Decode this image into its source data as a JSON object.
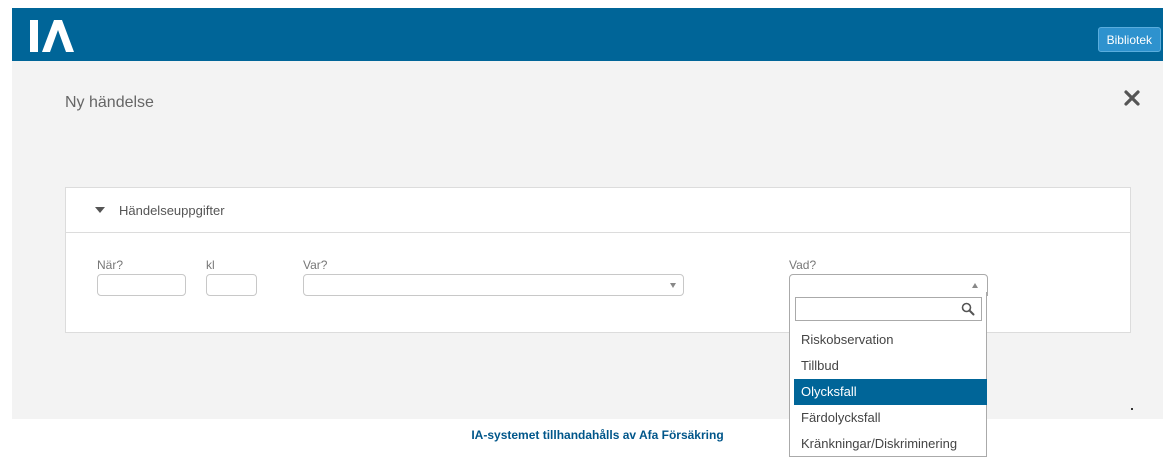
{
  "header": {
    "logo_text": "IA",
    "library_button": "Bibliotek",
    "brand_color": "#006598"
  },
  "dialog": {
    "title": "Ny händelse",
    "close_icon": "close-icon"
  },
  "section": {
    "title": "Händelseuppgifter",
    "expanded": true
  },
  "form": {
    "when_label": "När?",
    "when_value": "",
    "time_label": "kl",
    "time_value": "",
    "where_label": "Var?",
    "where_value": "",
    "what_label": "Vad?",
    "what_value": ""
  },
  "what_dropdown": {
    "open": true,
    "search_value": "",
    "options": [
      "Riskobservation",
      "Tillbud",
      "Olycksfall",
      "Färdolycksfall",
      "Kränkningar/Diskriminering"
    ],
    "highlighted": "Olycksfall"
  },
  "footer": {
    "text": "IA-systemet tillhandahålls av Afa Försäkring"
  }
}
